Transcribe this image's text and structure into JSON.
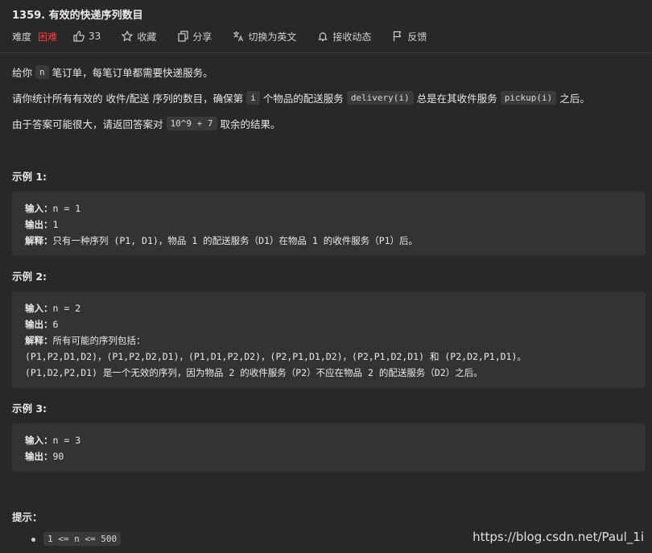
{
  "problem": {
    "title": "1359. 有效的快递序列数目"
  },
  "meta": {
    "difficulty_label": "难度",
    "difficulty_value": "困难",
    "difficulty_color": "#ff3b3b",
    "likes": "33",
    "favorite": "收藏",
    "share": "分享",
    "switch_lang": "切换为英文",
    "subscribe": "接收动态",
    "feedback": "反馈"
  },
  "desc": {
    "p1": {
      "a": "给你",
      "code": "n",
      "b": "笔订单，每笔订单都需要快递服务。"
    },
    "p2": {
      "a": "请你统计所有有效的 收件/配送 序列的数目，确保第",
      "code1": "i",
      "b": "个物品的配送服务",
      "code2": "delivery(i)",
      "c": "总是在其收件服务",
      "code3": "pickup(i)",
      "d": "之后。"
    },
    "p3": {
      "a": "由于答案可能很大，请返回答案对",
      "code": "10^9 + 7",
      "b": "取余的结果。"
    }
  },
  "examples": [
    {
      "heading": "示例 1:",
      "input_label": "输入：",
      "input": "n = 1",
      "output_label": "输出：",
      "output": "1",
      "explain_label": "解释：",
      "explain": "只有一种序列 (P1, D1)，物品 1 的配送服务（D1）在物品 1 的收件服务（P1）后。"
    },
    {
      "heading": "示例 2:",
      "input_label": "输入：",
      "input": "n = 2",
      "output_label": "输出：",
      "output": "6",
      "explain_label": "解释：",
      "explain": "所有可能的序列包括：",
      "extra1": "(P1,P2,D1,D2)，(P1,P2,D2,D1)，(P1,D1,P2,D2)，(P2,P1,D1,D2)，(P2,P1,D2,D1) 和 (P2,D2,P1,D1)。",
      "extra2": "(P1,D2,P2,D1) 是一个无效的序列，因为物品 2 的收件服务（P2）不应在物品 2 的配送服务（D2）之后。"
    },
    {
      "heading": "示例 3:",
      "input_label": "输入：",
      "input": "n = 3",
      "output_label": "输出：",
      "output": "90"
    }
  ],
  "hints": {
    "heading": "提示：",
    "items": [
      "1 <= n <= 500"
    ]
  },
  "watermark": "https://blog.csdn.net/Paul_1i",
  "icons": [
    "thumbs-up-icon",
    "star-icon",
    "share-icon",
    "translate-icon",
    "bell-icon",
    "flag-icon"
  ]
}
